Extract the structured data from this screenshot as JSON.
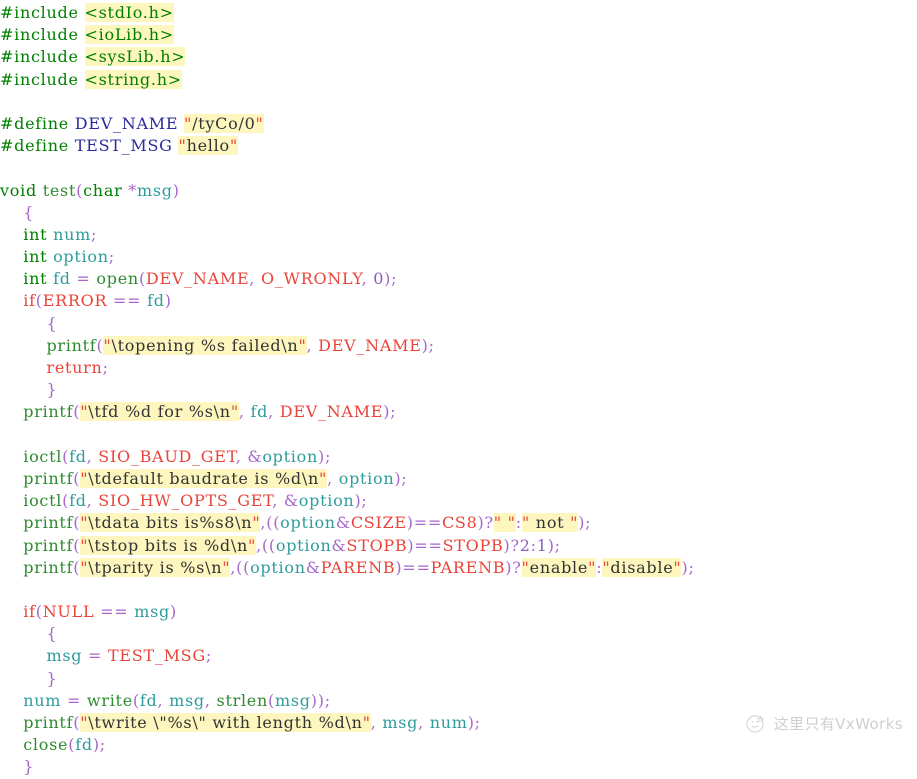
{
  "document": {
    "language": "C",
    "description": "VxWorks serial (tty) device test function source listing"
  },
  "theme": {
    "background": "#ffffff",
    "keyword": "#008000",
    "function": "#2e8b2e",
    "macro": "#e8443a",
    "define_name": "#2a2a9e",
    "variable": "#2f9c9c",
    "punctuation": "#a766cc",
    "number": "#8a5fbf",
    "string_text": "#333333",
    "string_quote": "#e8443a",
    "string_highlight": "#fdf7bf"
  },
  "code": {
    "lines": [
      "#include <stdIo.h>",
      "#include <ioLib.h>",
      "#include <sysLib.h>",
      "#include <string.h>",
      "",
      "#define DEV_NAME \"/tyCo/0\"",
      "#define TEST_MSG \"hello\"",
      "",
      "void test(char *msg)",
      "    {",
      "    int num;",
      "    int option;",
      "    int fd = open(DEV_NAME, O_WRONLY, 0);",
      "    if(ERROR == fd)",
      "        {",
      "        printf(\"\\topening %s failed\\n\", DEV_NAME);",
      "        return;",
      "        }",
      "    printf(\"\\tfd %d for %s\\n\", fd, DEV_NAME);",
      "",
      "    ioctl(fd, SIO_BAUD_GET, &option);",
      "    printf(\"\\tdefault baudrate is %d\\n\", option);",
      "    ioctl(fd, SIO_HW_OPTS_GET, &option);",
      "    printf(\"\\tdata bits is%s8\\n\",((option&CSIZE)==CS8)?\" \":\" not \");",
      "    printf(\"\\tstop bits is %d\\n\",((option&STOPB)==STOPB)?2:1);",
      "    printf(\"\\tparity is %s\\n\",((option&PARENB)==PARENB)?\"enable\":\"disable\");",
      "",
      "    if(NULL == msg)",
      "        {",
      "        msg = TEST_MSG;",
      "        }",
      "    num = write(fd, msg, strlen(msg));",
      "    printf(\"\\twrite \\\"%s\\\" with length %d\\n\", msg, num);",
      "    close(fd);",
      "    }"
    ],
    "includes": [
      "<stdIo.h>",
      "<ioLib.h>",
      "<sysLib.h>",
      "<string.h>"
    ],
    "defines": [
      {
        "name": "DEV_NAME",
        "value": "\"/tyCo/0\""
      },
      {
        "name": "TEST_MSG",
        "value": "\"hello\""
      }
    ],
    "function_signature": "void test(char *msg)",
    "locals": [
      "num",
      "option",
      "fd"
    ],
    "called_functions": [
      "open",
      "printf",
      "ioctl",
      "write",
      "strlen",
      "close"
    ],
    "constants": [
      "DEV_NAME",
      "O_WRONLY",
      "ERROR",
      "SIO_BAUD_GET",
      "SIO_HW_OPTS_GET",
      "CSIZE",
      "CS8",
      "STOPB",
      "PARENB",
      "NULL",
      "TEST_MSG"
    ],
    "strings": [
      "\"\\topening %s failed\\n\"",
      "\"\\tfd %d for %s\\n\"",
      "\"\\tdefault baudrate is %d\\n\"",
      "\"\\tdata bits is%s8\\n\"",
      "\" \"",
      "\" not \"",
      "\"\\tstop bits is %d\\n\"",
      "\"\\tparity is %s\\n\"",
      "\"enable\"",
      "\"disable\"",
      "\"\\twrite \\\"%s\\\" with length %d\\n\""
    ]
  },
  "watermark": {
    "text": "这里只有VxWorks",
    "icon": "circle-face-logo-icon"
  }
}
